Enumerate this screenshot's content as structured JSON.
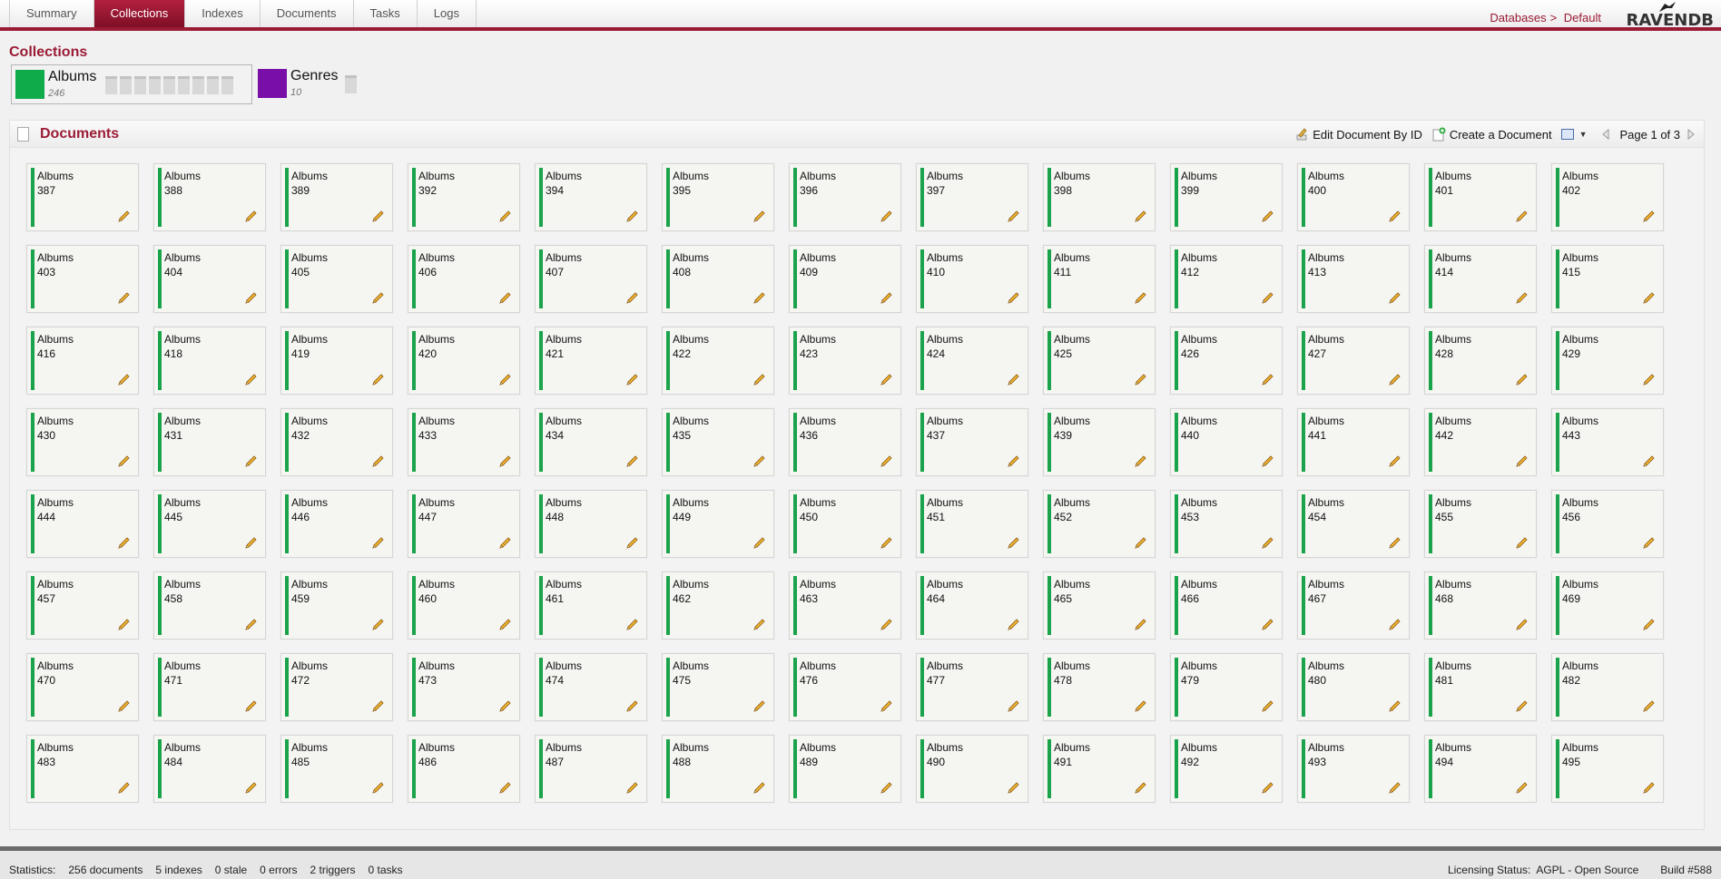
{
  "nav": {
    "tabs": [
      {
        "label": "Summary",
        "active": false
      },
      {
        "label": "Collections",
        "active": true
      },
      {
        "label": "Indexes",
        "active": false
      },
      {
        "label": "Documents",
        "active": false
      },
      {
        "label": "Tasks",
        "active": false
      },
      {
        "label": "Logs",
        "active": false
      }
    ],
    "breadcrumb": {
      "databases": "Databases",
      "separator": ">",
      "current": "Default"
    },
    "logo": "RAVENDB"
  },
  "collections": {
    "title": "Collections",
    "items": [
      {
        "name": "Albums",
        "count": "246",
        "color": "#0faa4a"
      },
      {
        "name": "Genres",
        "count": "10",
        "color": "#7a0fa8"
      }
    ]
  },
  "documents": {
    "title": "Documents",
    "edit_by_id": "Edit Document By ID",
    "create": "Create a Document",
    "pager": "Page 1 of 3",
    "card_collection": "Albums",
    "ids": [
      "387",
      "388",
      "389",
      "392",
      "394",
      "395",
      "396",
      "397",
      "398",
      "399",
      "400",
      "401",
      "402",
      "403",
      "404",
      "405",
      "406",
      "407",
      "408",
      "409",
      "410",
      "411",
      "412",
      "413",
      "414",
      "415",
      "416",
      "418",
      "419",
      "420",
      "421",
      "422",
      "423",
      "424",
      "425",
      "426",
      "427",
      "428",
      "429",
      "430",
      "431",
      "432",
      "433",
      "434",
      "435",
      "436",
      "437",
      "439",
      "440",
      "441",
      "442",
      "443",
      "444",
      "445",
      "446",
      "447",
      "448",
      "449",
      "450",
      "451",
      "452",
      "453",
      "454",
      "455",
      "456",
      "457",
      "458",
      "459",
      "460",
      "461",
      "462",
      "463",
      "464",
      "465",
      "466",
      "467",
      "468",
      "469",
      "470",
      "471",
      "472",
      "473",
      "474",
      "475",
      "476",
      "477",
      "478",
      "479",
      "480",
      "481",
      "482",
      "483",
      "484",
      "485",
      "486",
      "487",
      "488",
      "489",
      "490",
      "491",
      "492",
      "493",
      "494",
      "495"
    ]
  },
  "status": {
    "label": "Statistics:",
    "documents": "256 documents",
    "indexes": "5 indexes",
    "stale": "0 stale",
    "errors": "0 errors",
    "triggers": "2 triggers",
    "tasks": "0 tasks",
    "licensing": "Licensing Status:  AGPL - Open Source",
    "build": "Build #588"
  }
}
